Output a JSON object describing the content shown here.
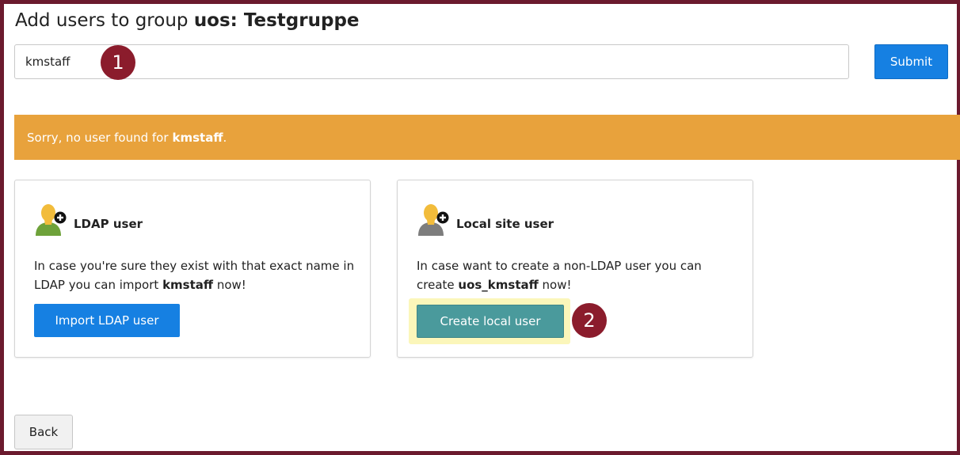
{
  "header": {
    "title_prefix": "Add users to group ",
    "group_name": "uos: Testgruppe"
  },
  "search": {
    "value": "kmstaff",
    "submit_label": "Submit"
  },
  "markers": [
    "1",
    "2"
  ],
  "alert": {
    "text": "Sorry, no user found for",
    "username": "kmstaff",
    "suffix": ".",
    "color": "#e8a23c"
  },
  "cards": {
    "ldap": {
      "icon": "add-user-icon",
      "title": "LDAP user",
      "text_before": "In case you're sure they exist with that exact name in LDAP you can import ",
      "username": "kmstaff",
      "text_after": " now!",
      "button_label": "Import LDAP user"
    },
    "local": {
      "icon": "add-user-icon",
      "title": "Local site user",
      "text_before": "In case want to create a non-LDAP user you can create ",
      "username": "uos_kmstaff",
      "text_after": " now!",
      "button_label": "Create local user"
    }
  },
  "footer": {
    "back_label": "Back"
  },
  "colors": {
    "primary_button": "#1680e2",
    "create_button": "#4a9a9c",
    "marker": "#8b1c2c",
    "frame": "#6b1a2e"
  }
}
